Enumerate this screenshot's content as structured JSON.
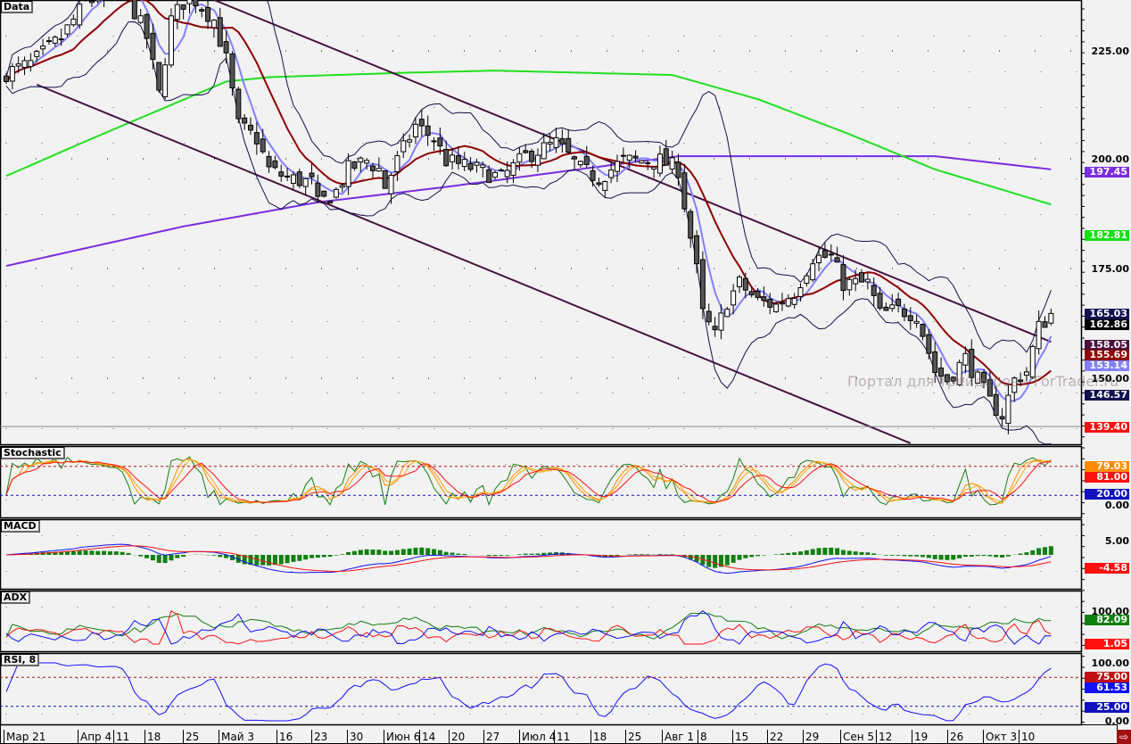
{
  "panels": {
    "main": "Data",
    "stoch": "Stochastic",
    "macd": "MACD",
    "adx": "ADX",
    "rsi": "RSI, 8"
  },
  "watermark": "Портал для трейдеров - ForTrader.ru",
  "price_ticks": [
    "225.00",
    "200.00",
    "175.00",
    "150.00"
  ],
  "price_labels": [
    {
      "text": "197.45",
      "color": "#7a2ce0"
    },
    {
      "text": "182.81",
      "color": "#10e010"
    },
    {
      "text": "165.03",
      "color": "#101050"
    },
    {
      "text": "162.86",
      "color": "#000000"
    },
    {
      "text": "158.05",
      "color": "#4a1040"
    },
    {
      "text": "155.69",
      "color": "#900000"
    },
    {
      "text": "153.14",
      "color": "#8080ff"
    },
    {
      "text": "146.57",
      "color": "#101050"
    },
    {
      "text": "139.40",
      "color": "#ff1010"
    }
  ],
  "stoch_ticks": [
    "0.00"
  ],
  "stoch_labels": [
    {
      "text": "79.03",
      "color": "#ff8c00"
    },
    {
      "text": "81.00",
      "color": "#ff1010"
    },
    {
      "text": "20.00",
      "color": "#1010c0"
    }
  ],
  "macd_ticks": [
    "5.00"
  ],
  "macd_labels": [
    {
      "text": "-4.58",
      "color": "#ff1010"
    }
  ],
  "adx_ticks": [
    "100.00"
  ],
  "adx_labels": [
    {
      "text": "82.09",
      "color": "#108010"
    },
    {
      "text": "1.05",
      "color": "#ff1010"
    }
  ],
  "rsi_ticks": [
    "100.00",
    "0.00"
  ],
  "rsi_labels": [
    {
      "text": "75.00",
      "color": "#c01010"
    },
    {
      "text": "61.53",
      "color": "#1010ff"
    },
    {
      "text": "25.00",
      "color": "#1010c0"
    }
  ],
  "dates": [
    "Мар 21",
    "Апр 4",
    "11",
    "18",
    "25",
    "Май 3",
    "16",
    "23",
    "30",
    "Июн 6",
    "14",
    "20",
    "27",
    "Июл 4",
    "11",
    "18",
    "25",
    "Авг 1",
    "8",
    "15",
    "22",
    "29",
    "Сен 5",
    "12",
    "19",
    "26",
    "Окт 3",
    "10"
  ],
  "exit_icon": "exit-icon",
  "chart_data": {
    "type": "candlestick",
    "title": "Data",
    "ylim": [
      135,
      237
    ],
    "bars": 172,
    "close_keypoints": [
      [
        0,
        220
      ],
      [
        4,
        222
      ],
      [
        9,
        228
      ],
      [
        13,
        236
      ],
      [
        19,
        240
      ],
      [
        23,
        228
      ],
      [
        25,
        215
      ],
      [
        27,
        232
      ],
      [
        30,
        238
      ],
      [
        34,
        232
      ],
      [
        36,
        223
      ],
      [
        38,
        208
      ],
      [
        41,
        205
      ],
      [
        43,
        198
      ],
      [
        46,
        196
      ],
      [
        50,
        195
      ],
      [
        51,
        190
      ],
      [
        54,
        193
      ],
      [
        56,
        198
      ],
      [
        59,
        200
      ],
      [
        61,
        198
      ],
      [
        62,
        194
      ],
      [
        64,
        200
      ],
      [
        67,
        208
      ],
      [
        70,
        205
      ],
      [
        72,
        200
      ],
      [
        77,
        198
      ],
      [
        81,
        196
      ],
      [
        85,
        201
      ],
      [
        90,
        204
      ],
      [
        94,
        198
      ],
      [
        97,
        196
      ],
      [
        101,
        200
      ],
      [
        107,
        200
      ],
      [
        110,
        198
      ],
      [
        111,
        190
      ],
      [
        113,
        175
      ],
      [
        114,
        165
      ],
      [
        116,
        160
      ],
      [
        118,
        168
      ],
      [
        120,
        172
      ],
      [
        123,
        168
      ],
      [
        126,
        167
      ],
      [
        129,
        170
      ],
      [
        132,
        178
      ],
      [
        135,
        178
      ],
      [
        137,
        172
      ],
      [
        141,
        172
      ],
      [
        143,
        165
      ],
      [
        146,
        166
      ],
      [
        149,
        165
      ],
      [
        152,
        152
      ],
      [
        154,
        150
      ],
      [
        157,
        155
      ],
      [
        159,
        150
      ],
      [
        161,
        145
      ],
      [
        163,
        142
      ],
      [
        165,
        150
      ],
      [
        167,
        152
      ],
      [
        169,
        162
      ],
      [
        171,
        165
      ]
    ],
    "ma200_keypoints": [
      [
        0,
        196.5
      ],
      [
        14,
        205
      ],
      [
        36,
        218
      ],
      [
        43,
        219
      ],
      [
        65,
        220
      ],
      [
        80,
        220.5
      ],
      [
        109,
        219.5
      ],
      [
        123,
        214
      ],
      [
        138,
        206
      ],
      [
        152,
        198
      ],
      [
        171,
        190
      ]
    ],
    "ma_long_keypoints": [
      [
        0,
        176
      ],
      [
        29,
        185
      ],
      [
        51,
        190.5
      ],
      [
        72,
        194
      ],
      [
        110,
        201
      ],
      [
        152,
        201
      ],
      [
        171,
        198
      ]
    ],
    "channel": {
      "upper": [
        [
          34,
          236.6
        ],
        [
          171,
          158.7
        ]
      ],
      "lower": [
        [
          5,
          217.3
        ],
        [
          148,
          135.6
        ]
      ]
    },
    "support_level": 139.4,
    "stoch_levels": [
      20,
      80
    ],
    "rsi_levels": [
      25,
      75
    ]
  }
}
